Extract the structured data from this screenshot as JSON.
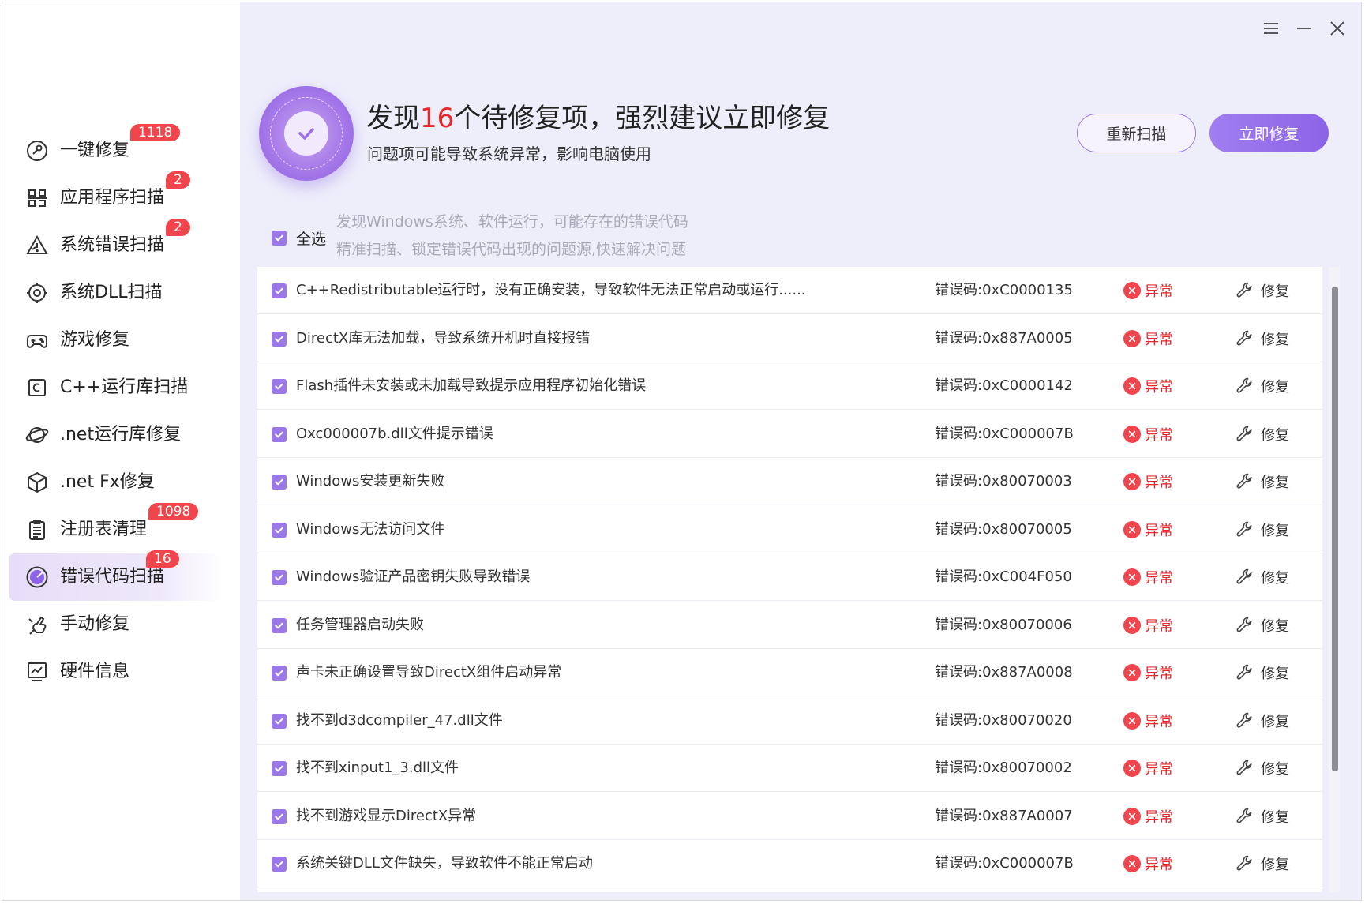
{
  "sidebar": {
    "items": [
      {
        "label": "一键修复",
        "badge": "1118",
        "icon": "repair-tool-icon",
        "active": false
      },
      {
        "label": "应用程序扫描",
        "badge": "2",
        "icon": "app-scan-icon",
        "active": false
      },
      {
        "label": "系统错误扫描",
        "badge": "2",
        "icon": "warning-icon",
        "active": false
      },
      {
        "label": "系统DLL扫描",
        "badge": "",
        "icon": "gear-icon",
        "active": false
      },
      {
        "label": "游戏修复",
        "badge": "",
        "icon": "gamepad-icon",
        "active": false
      },
      {
        "label": "C++运行库扫描",
        "badge": "",
        "icon": "cpp-icon",
        "active": false
      },
      {
        "label": ".net运行库修复",
        "badge": "",
        "icon": "planet-icon",
        "active": false
      },
      {
        "label": ".net Fx修复",
        "badge": "",
        "icon": "cube-icon",
        "active": false
      },
      {
        "label": "注册表清理",
        "badge": "1098",
        "icon": "clipboard-icon",
        "active": false
      },
      {
        "label": "错误代码扫描",
        "badge": "16",
        "icon": "radar-icon",
        "active": true
      },
      {
        "label": "手动修复",
        "badge": "",
        "icon": "hand-icon",
        "active": false
      },
      {
        "label": "硬件信息",
        "badge": "",
        "icon": "monitor-icon",
        "active": false
      }
    ]
  },
  "header": {
    "title_prefix": "发现",
    "title_count": "16",
    "title_suffix": "个待修复项，强烈建议立即修复",
    "subtitle": "问题项可能导致系统异常，影响电脑使用",
    "rescan_label": "重新扫描",
    "fix_label": "立即修复"
  },
  "select_all": {
    "label": "全选",
    "hint_line1": "发现Windows系统、软件运行，可能存在的错误代码",
    "hint_line2": "精准扫描、锁定错误代码出现的问题源,快速解决问题"
  },
  "rows": [
    {
      "desc": "C++Redistributable运行时，没有正确安装，导致软件无法正常启动或运行......",
      "code": "错误码:0xC0000135",
      "status": "异常",
      "action": "修复"
    },
    {
      "desc": "DirectX库无法加载，导致系统开机时直接报错",
      "code": "错误码:0x887A0005",
      "status": "异常",
      "action": "修复"
    },
    {
      "desc": "Flash插件未安装或未加载导致提示应用程序初始化错误",
      "code": "错误码:0xC0000142",
      "status": "异常",
      "action": "修复"
    },
    {
      "desc": "Oxc000007b.dll文件提示错误",
      "code": "错误码:0xC000007B",
      "status": "异常",
      "action": "修复"
    },
    {
      "desc": "Windows安装更新失败",
      "code": "错误码:0x80070003",
      "status": "异常",
      "action": "修复"
    },
    {
      "desc": "Windows无法访问文件",
      "code": "错误码:0x80070005",
      "status": "异常",
      "action": "修复"
    },
    {
      "desc": "Windows验证产品密钥失败导致错误",
      "code": "错误码:0xC004F050",
      "status": "异常",
      "action": "修复"
    },
    {
      "desc": "任务管理器启动失败",
      "code": "错误码:0x80070006",
      "status": "异常",
      "action": "修复"
    },
    {
      "desc": "声卡未正确设置导致DirectX组件启动异常",
      "code": "错误码:0x887A0008",
      "status": "异常",
      "action": "修复"
    },
    {
      "desc": "找不到d3dcompiler_47.dll文件",
      "code": "错误码:0x80070020",
      "status": "异常",
      "action": "修复"
    },
    {
      "desc": "找不到xinput1_3.dll文件",
      "code": "错误码:0x80070002",
      "status": "异常",
      "action": "修复"
    },
    {
      "desc": "找不到游戏显示DirectX异常",
      "code": "错误码:0x887A0007",
      "status": "异常",
      "action": "修复"
    },
    {
      "desc": "系统关键DLL文件缺失，导致软件不能正常启动",
      "code": "错误码:0xC000007B",
      "status": "异常",
      "action": "修复"
    }
  ],
  "colors": {
    "accent": "#9a78e8",
    "error": "#e6262b",
    "badge": "#f0454c",
    "main_bg": "#eeeefb"
  }
}
